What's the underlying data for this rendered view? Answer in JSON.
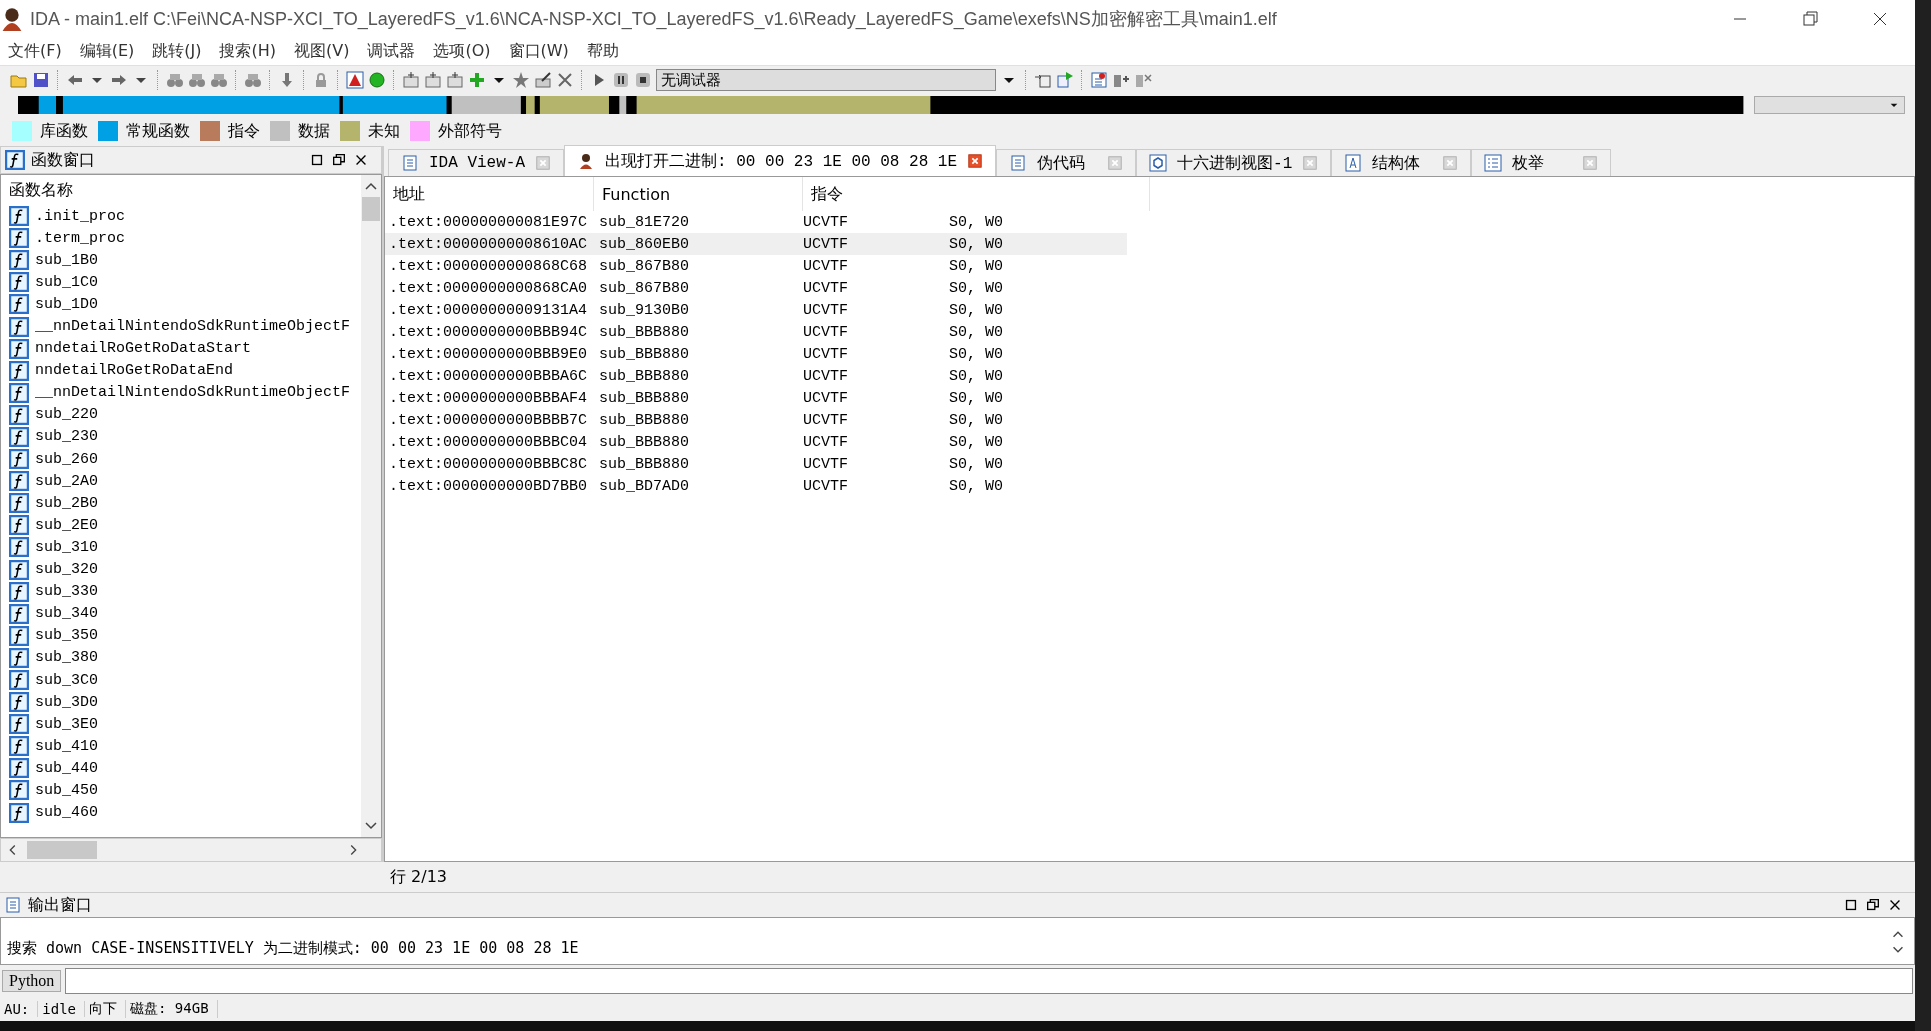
{
  "window": {
    "title": "IDA - main1.elf C:\\Fei\\NCA-NSP-XCI_TO_LayeredFS_v1.6\\NCA-NSP-XCI_TO_LayeredFS_v1.6\\Ready_LayeredFS_Game\\exefs\\NS加密解密工具\\main1.elf"
  },
  "menu": [
    "文件(F)",
    "编辑(E)",
    "跳转(J)",
    "搜索(H)",
    "视图(V)",
    "调试器",
    "选项(O)",
    "窗口(W)",
    "帮助"
  ],
  "toolbar": {
    "debugger_select": "无调试器"
  },
  "legend": [
    {
      "label": "库函数",
      "color": "#a6ffff"
    },
    {
      "label": "常规函数",
      "color": "#00a0e4"
    },
    {
      "label": "指令",
      "color": "#b87c5c"
    },
    {
      "label": "数据",
      "color": "#c0c0c0"
    },
    {
      "label": "未知",
      "color": "#b4b46c"
    },
    {
      "label": "外部符号",
      "color": "#ffa8ff"
    }
  ],
  "functions_window": {
    "title": "函数窗口",
    "column": "函数名称",
    "items": [
      ".init_proc",
      ".term_proc",
      "sub_1B0",
      "sub_1C0",
      "sub_1D0",
      "__nnDetailNintendoSdkRuntimeObjectF",
      "nndetailRoGetRoDataStart",
      "nndetailRoGetRoDataEnd",
      "__nnDetailNintendoSdkRuntimeObjectF",
      "sub_220",
      "sub_230",
      "sub_260",
      "sub_2A0",
      "sub_2B0",
      "sub_2E0",
      "sub_310",
      "sub_320",
      "sub_330",
      "sub_340",
      "sub_350",
      "sub_380",
      "sub_3C0",
      "sub_3D0",
      "sub_3E0",
      "sub_410",
      "sub_440",
      "sub_450",
      "sub_460"
    ]
  },
  "tabs": [
    {
      "label": "IDA View-A",
      "selected": false,
      "kind": "view"
    },
    {
      "label": "出现打开二进制: 00 00 23 1E 00 08 28 1E",
      "selected": true,
      "kind": "search"
    },
    {
      "label": "伪代码",
      "selected": false,
      "kind": "view"
    },
    {
      "label": "十六进制视图-1",
      "selected": false,
      "kind": "hex"
    },
    {
      "label": "结构体",
      "selected": false,
      "kind": "struct"
    },
    {
      "label": "枚举",
      "selected": false,
      "kind": "enum"
    }
  ],
  "table": {
    "columns": [
      "地址",
      "Function",
      "指令"
    ],
    "rows": [
      {
        "address": ".text:000000000081E97C",
        "function": "sub_81E720",
        "instruction": "UCVTF",
        "column_4": "S0, W0",
        "selected": false
      },
      {
        "address": ".text:00000000008610AC",
        "function": "sub_860EB0",
        "instruction": "UCVTF",
        "column_4": "S0, W0",
        "selected": true
      },
      {
        "address": ".text:0000000000868C68",
        "function": "sub_867B80",
        "instruction": "UCVTF",
        "column_4": "S0, W0",
        "selected": false
      },
      {
        "address": ".text:0000000000868CA0",
        "function": "sub_867B80",
        "instruction": "UCVTF",
        "column_4": "S0, W0",
        "selected": false
      },
      {
        "address": ".text:00000000009131A4",
        "function": "sub_9130B0",
        "instruction": "UCVTF",
        "column_4": "S0, W0",
        "selected": false
      },
      {
        "address": ".text:0000000000BBB94C",
        "function": "sub_BBB880",
        "instruction": "UCVTF",
        "column_4": "S0, W0",
        "selected": false
      },
      {
        "address": ".text:0000000000BBB9E0",
        "function": "sub_BBB880",
        "instruction": "UCVTF",
        "column_4": "S0, W0",
        "selected": false
      },
      {
        "address": ".text:0000000000BBBA6C",
        "function": "sub_BBB880",
        "instruction": "UCVTF",
        "column_4": "S0, W0",
        "selected": false
      },
      {
        "address": ".text:0000000000BBBAF4",
        "function": "sub_BBB880",
        "instruction": "UCVTF",
        "column_4": "S0, W0",
        "selected": false
      },
      {
        "address": ".text:0000000000BBBB7C",
        "function": "sub_BBB880",
        "instruction": "UCVTF",
        "column_4": "S0, W0",
        "selected": false
      },
      {
        "address": ".text:0000000000BBBC04",
        "function": "sub_BBB880",
        "instruction": "UCVTF",
        "column_4": "S0, W0",
        "selected": false
      },
      {
        "address": ".text:0000000000BBBC8C",
        "function": "sub_BBB880",
        "instruction": "UCVTF",
        "column_4": "S0, W0",
        "selected": false
      },
      {
        "address": ".text:0000000000BD7BB0",
        "function": "sub_BD7AD0",
        "instruction": "UCVTF",
        "column_4": "S0, W0",
        "selected": false
      }
    ]
  },
  "row_counter": "行 2/13",
  "output_window": {
    "title": "输出窗口",
    "lines": [
      "搜索 down CASE-INSENSITIVELY 为二进制模式: 00 00 23 1E 00 08 28 1E"
    ],
    "language_button": "Python"
  },
  "status_bar": {
    "au_label": "AU:",
    "au_state": "idle",
    "direction": "向下",
    "disk": "磁盘: 94GB"
  }
}
